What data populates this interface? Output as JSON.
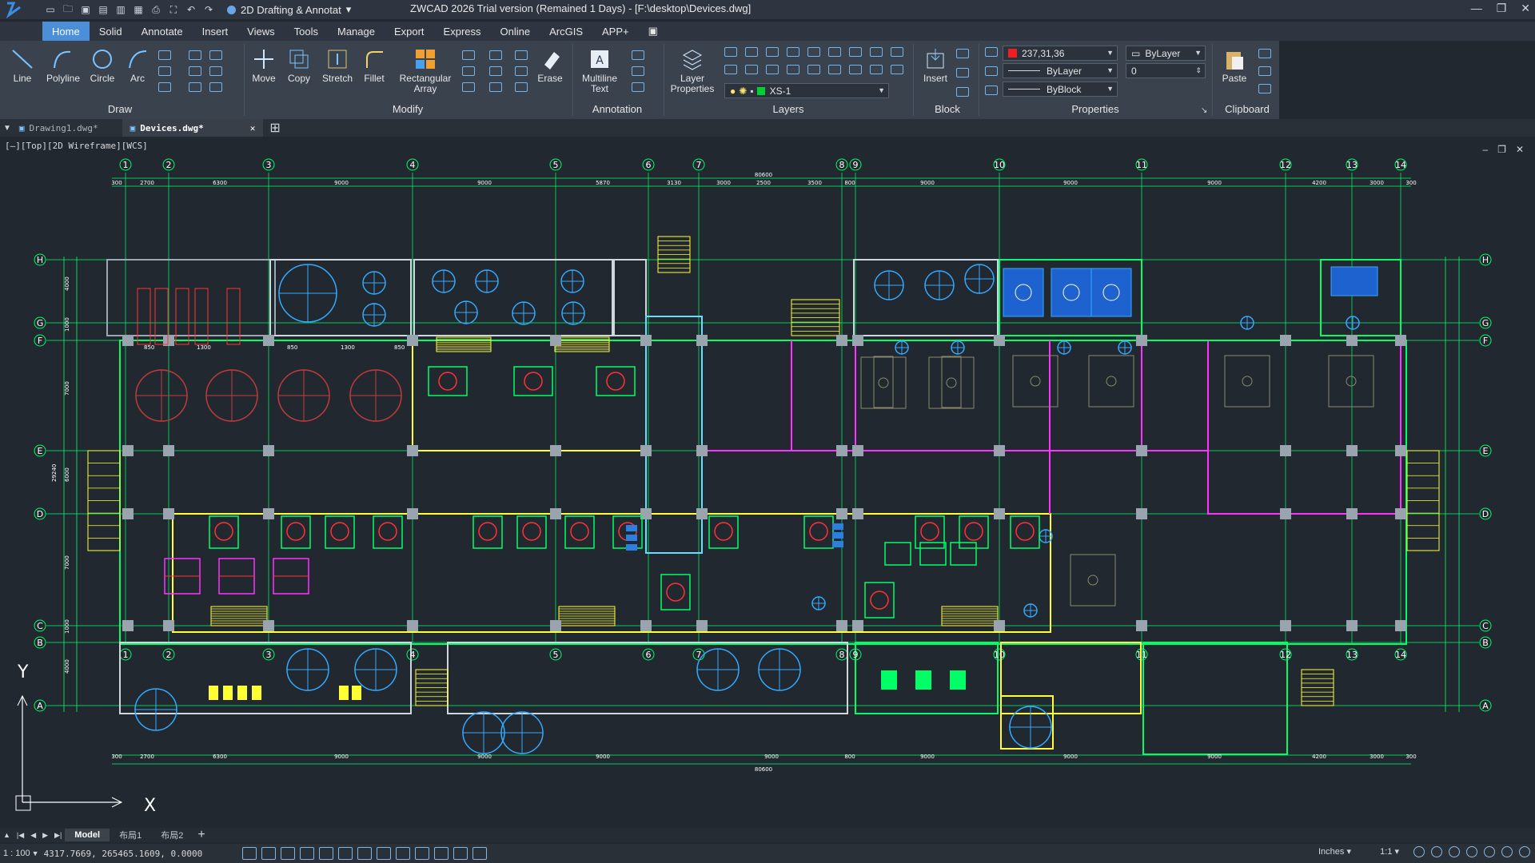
{
  "app": {
    "title": "ZWCAD 2026 Trial version (Remained 1 Days) - [F:\\desktop\\Devices.dwg]",
    "workspace": "2D Drafting & Annotat"
  },
  "menu_tabs": [
    "Home",
    "Solid",
    "Annotate",
    "Insert",
    "Views",
    "Tools",
    "Manage",
    "Export",
    "Express",
    "Online",
    "ArcGIS",
    "APP+"
  ],
  "ribbon": {
    "draw": {
      "line": "Line",
      "polyline": "Polyline",
      "circle": "Circle",
      "arc": "Arc",
      "group": "Draw"
    },
    "modify": {
      "move": "Move",
      "copy": "Copy",
      "stretch": "Stretch",
      "fillet": "Fillet",
      "rect_array": "Rectangular\nArray",
      "erase": "Erase",
      "group": "Modify"
    },
    "annotation": {
      "mtext": "Multiline\nText",
      "group": "Annotation"
    },
    "layers": {
      "layer_props": "Layer\nProperties",
      "current": "XS-1",
      "group": "Layers"
    },
    "block": {
      "insert": "Insert",
      "group": "Block"
    },
    "properties": {
      "color": "237,31,36",
      "bylayer": "ByLayer",
      "linetype": "ByLayer",
      "lineweight": "ByBlock",
      "transparency": "0",
      "group": "Properties"
    },
    "clipboard": {
      "paste": "Paste",
      "group": "Clipboard"
    }
  },
  "doc_tabs": [
    "Drawing1.dwg*",
    "Devices.dwg*"
  ],
  "viewport_label": "[–][Top][2D Wireframe][WCS]",
  "grid": {
    "columns": [
      "1",
      "2",
      "3",
      "4",
      "5",
      "6",
      "7",
      "8",
      "9",
      "10",
      "11",
      "12",
      "13",
      "14"
    ],
    "rows": [
      "H",
      "G",
      "F",
      "E",
      "D",
      "C",
      "B",
      "A"
    ],
    "top_dims": [
      "300",
      "2700",
      "6300",
      "9000",
      "9000",
      "5870",
      "3130",
      "3000",
      "2500",
      "3500",
      "800",
      "9000",
      "9000",
      "9000",
      "4200",
      "3000",
      "300"
    ],
    "total_dim": "80600",
    "bottom_dims": [
      "300",
      "2700",
      "6300",
      "9000",
      "9000",
      "9000",
      "9000",
      "800",
      "9000",
      "9000",
      "9000",
      "4200",
      "3000",
      "300"
    ],
    "left_dims": [
      "4000",
      "1000",
      "7000",
      "6000",
      "7000",
      "1000",
      "4000"
    ],
    "left_total": "29240",
    "inner_dims": [
      "850",
      "1300",
      "850",
      "1300",
      "850"
    ]
  },
  "layout_tabs": [
    "Model",
    "布局1",
    "布局2"
  ],
  "status": {
    "coords": "4317.7669, 265465.1609, 0.0000",
    "scale_text": "1 : 100",
    "units": "Inches",
    "anno_scale": "1:1"
  },
  "colors": {
    "background": "#212830",
    "grid": "#00ff66",
    "wall_yellow": "#ffff33",
    "wall_magenta": "#ff33ff",
    "wall_cyan": "#66ddff",
    "device_red": "#ff3333",
    "device_blue": "#33aaff"
  }
}
